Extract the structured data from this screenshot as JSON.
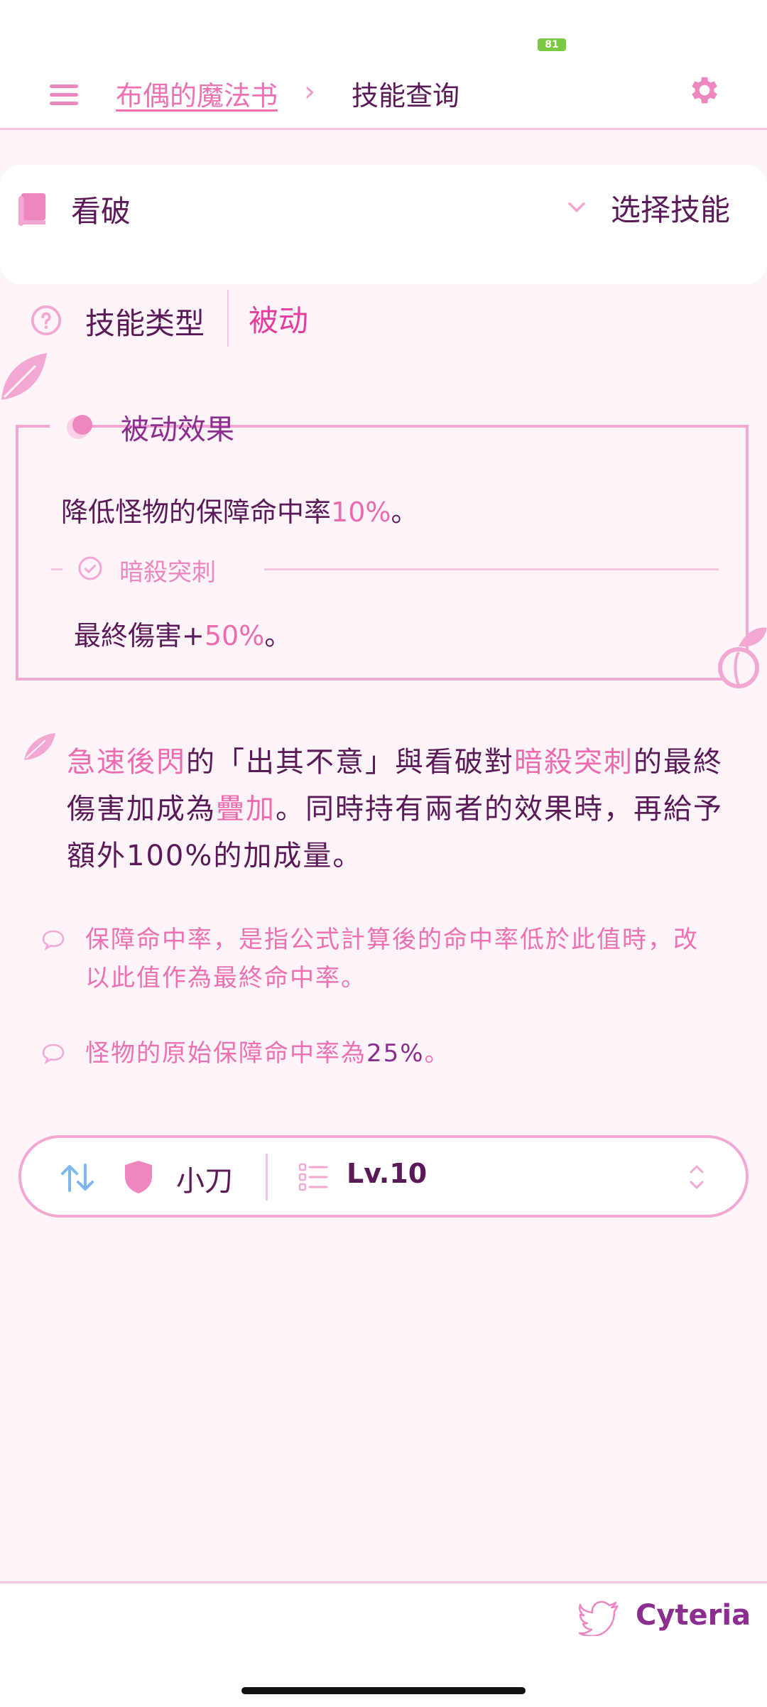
{
  "status_bar": {
    "battery": "81"
  },
  "header": {
    "breadcrumb_link": "布偶的魔法书",
    "breadcrumb_separator": "›",
    "breadcrumb_current": "技能查询"
  },
  "skill_selector": {
    "selected": "看破",
    "choose_label": "选择技能"
  },
  "skill_type": {
    "label": "技能类型",
    "value": "被动"
  },
  "passive": {
    "title": "被动效果",
    "line1_prefix": "降低怪物的保障命中率",
    "line1_value": "10%",
    "line1_suffix": "。",
    "sub_title": "暗殺突刺",
    "line2_prefix": "最終傷害+",
    "line2_value": "50%",
    "line2_suffix": "。"
  },
  "description": {
    "p1": "急速後閃",
    "p2": "的「出其不意」與看破對",
    "p3": "暗殺突刺",
    "p4": "的最終傷害加成為",
    "p5": "疊加",
    "p6": "。同時持有兩者的效果時，再給予額外100%的加成量。"
  },
  "notes": {
    "note1": "保障命中率，是指公式計算後的命中率低於此值時，改以此值作為最終命中率。",
    "note2_prefix": "怪物的原始保障命中率為",
    "note2_value": "25%",
    "note2_suffix": "。"
  },
  "weapon_bar": {
    "weapon": "小刀",
    "level": "Lv.10"
  },
  "footer": {
    "brand": "Cyteria"
  },
  "colors": {
    "accent_pink": "#ee72b2",
    "accent_magenta": "#e53ea0",
    "text_dark": "#5a1a57",
    "purple": "#8b2e8f"
  }
}
